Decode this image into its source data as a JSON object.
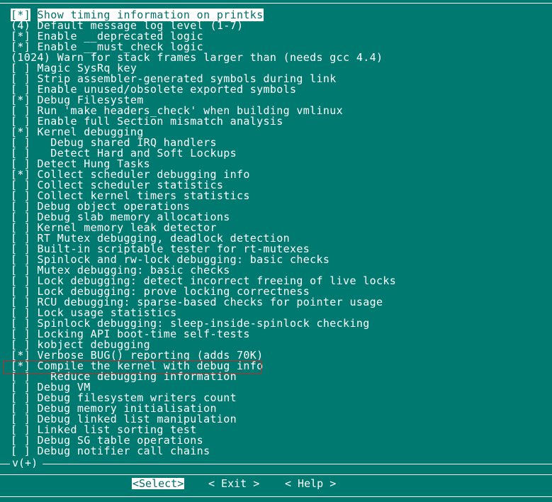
{
  "menu": {
    "items": [
      {
        "prefix": "[*]",
        "label": "Show timing information on printks",
        "selected": true
      },
      {
        "prefix": "(4)",
        "label": "Default message log level (1-7)"
      },
      {
        "prefix": "[*]",
        "label": "Enable __deprecated logic"
      },
      {
        "prefix": "[*]",
        "label": "Enable __must_check logic"
      },
      {
        "prefix": "(1024)",
        "label": "Warn for stack frames larger than (needs gcc 4.4)"
      },
      {
        "prefix": "[ ]",
        "label": "Magic SysRq key"
      },
      {
        "prefix": "[ ]",
        "label": "Strip assembler-generated symbols during link"
      },
      {
        "prefix": "[ ]",
        "label": "Enable unused/obsolete exported symbols"
      },
      {
        "prefix": "[*]",
        "label": "Debug Filesystem"
      },
      {
        "prefix": "[ ]",
        "label": "Run 'make headers_check' when building vmlinux"
      },
      {
        "prefix": "[ ]",
        "label": "Enable full Section mismatch analysis"
      },
      {
        "prefix": "[*]",
        "label": "Kernel debugging"
      },
      {
        "prefix": "[ ]",
        "label": "  Debug shared IRQ handlers"
      },
      {
        "prefix": "[ ]",
        "label": "  Detect Hard and Soft Lockups"
      },
      {
        "prefix": "[ ]",
        "label": "Detect Hung Tasks"
      },
      {
        "prefix": "[*]",
        "label": "Collect scheduler debugging info"
      },
      {
        "prefix": "[ ]",
        "label": "Collect scheduler statistics"
      },
      {
        "prefix": "[ ]",
        "label": "Collect kernel timers statistics"
      },
      {
        "prefix": "[ ]",
        "label": "Debug object operations"
      },
      {
        "prefix": "[ ]",
        "label": "Debug slab memory allocations"
      },
      {
        "prefix": "[ ]",
        "label": "Kernel memory leak detector"
      },
      {
        "prefix": "[ ]",
        "label": "RT Mutex debugging, deadlock detection"
      },
      {
        "prefix": "[ ]",
        "label": "Built-in scriptable tester for rt-mutexes"
      },
      {
        "prefix": "[ ]",
        "label": "Spinlock and rw-lock debugging: basic checks"
      },
      {
        "prefix": "[ ]",
        "label": "Mutex debugging: basic checks"
      },
      {
        "prefix": "[ ]",
        "label": "Lock debugging: detect incorrect freeing of live locks"
      },
      {
        "prefix": "[ ]",
        "label": "Lock debugging: prove locking correctness"
      },
      {
        "prefix": "[ ]",
        "label": "RCU debugging: sparse-based checks for pointer usage"
      },
      {
        "prefix": "[ ]",
        "label": "Lock usage statistics"
      },
      {
        "prefix": "[ ]",
        "label": "Spinlock debugging: sleep-inside-spinlock checking"
      },
      {
        "prefix": "[ ]",
        "label": "Locking API boot-time self-tests"
      },
      {
        "prefix": "[ ]",
        "label": "kobject debugging"
      },
      {
        "prefix": "[*]",
        "label": "Verbose BUG() reporting (adds 70K)"
      },
      {
        "prefix": "[*]",
        "label": "Compile the kernel with debug info"
      },
      {
        "prefix": "[ ]",
        "label": "  Reduce debugging information"
      },
      {
        "prefix": "[ ]",
        "label": "Debug VM"
      },
      {
        "prefix": "[ ]",
        "label": "Debug filesystem writers count"
      },
      {
        "prefix": "[ ]",
        "label": "Debug memory initialisation"
      },
      {
        "prefix": "[ ]",
        "label": "Debug linked list manipulation"
      },
      {
        "prefix": "[ ]",
        "label": "Linked list sorting test"
      },
      {
        "prefix": "[ ]",
        "label": "Debug SG table operations"
      },
      {
        "prefix": "[ ]",
        "label": "Debug notifier call chains"
      }
    ]
  },
  "scroll": {
    "indicator": "v(+)"
  },
  "buttons": {
    "select": "<Select>",
    "exit": "< Exit >",
    "help": "< Help >"
  },
  "colors": {
    "background": "#007a70",
    "foreground": "#ffffff",
    "highlight_box": "#c42a2a"
  }
}
